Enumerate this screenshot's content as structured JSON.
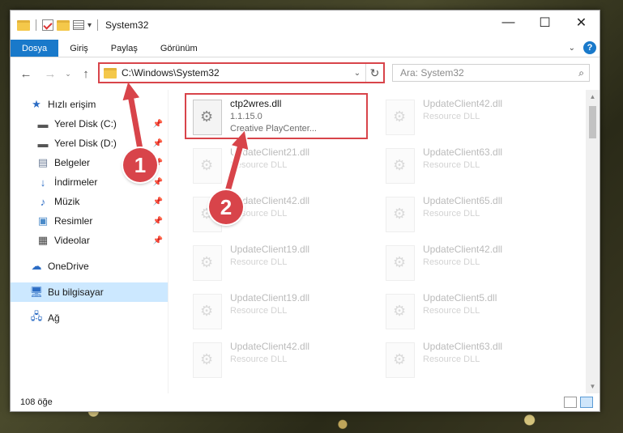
{
  "window": {
    "title": "System32",
    "buttons": {
      "minimize": "—",
      "maximize": "☐",
      "close": "✕"
    }
  },
  "ribbon": {
    "tabs": [
      "Dosya",
      "Giriş",
      "Paylaş",
      "Görünüm"
    ],
    "help": "?"
  },
  "navbar": {
    "back": "←",
    "forward": "→",
    "up": "↑",
    "address": "C:\\Windows\\System32",
    "search_placeholder": "Ara: System32"
  },
  "sidebar": {
    "quick_access": "Hızlı erişim",
    "items": [
      {
        "label": "Yerel Disk (C:)",
        "icon": "drive-icon"
      },
      {
        "label": "Yerel Disk (D:)",
        "icon": "drive-icon"
      },
      {
        "label": "Belgeler",
        "icon": "documents-icon"
      },
      {
        "label": "İndirmeler",
        "icon": "download-icon"
      },
      {
        "label": "Müzik",
        "icon": "music-icon"
      },
      {
        "label": "Resimler",
        "icon": "pictures-icon"
      },
      {
        "label": "Videolar",
        "icon": "video-icon"
      }
    ],
    "onedrive": "OneDrive",
    "this_pc": "Bu bilgisayar",
    "network": "Ağ"
  },
  "files": {
    "highlighted": {
      "name": "ctp2wres.dll",
      "version": "1.1.15.0",
      "description": "Creative PlayCenter..."
    },
    "column1": [
      {
        "name": "UpdateClient21.dll",
        "sub": "Resource DLL"
      },
      {
        "name": "UpdateClient42.dll",
        "sub": "Resource DLL"
      },
      {
        "name": "UpdateClient19.dll",
        "sub": "Resource DLL"
      },
      {
        "name": "UpdateClient19.dll",
        "sub": "Resource DLL"
      },
      {
        "name": "UpdateClient42.dll",
        "sub": "Resource DLL"
      }
    ],
    "column2": [
      {
        "name": "UpdateClient42.dll",
        "sub": "Resource DLL"
      },
      {
        "name": "UpdateClient63.dll",
        "sub": "Resource DLL"
      },
      {
        "name": "UpdateClient65.dll",
        "sub": "Resource DLL"
      },
      {
        "name": "UpdateClient42.dll",
        "sub": "Resource DLL"
      },
      {
        "name": "UpdateClient5.dll",
        "sub": "Resource DLL"
      },
      {
        "name": "UpdateClient63.dll",
        "sub": "Resource DLL"
      }
    ]
  },
  "status": {
    "count": "108 öğe"
  },
  "annotations": {
    "step1": "1",
    "step2": "2"
  },
  "colors": {
    "accent": "#1979ca",
    "highlight": "#d8444a",
    "selected": "#cce8ff"
  }
}
